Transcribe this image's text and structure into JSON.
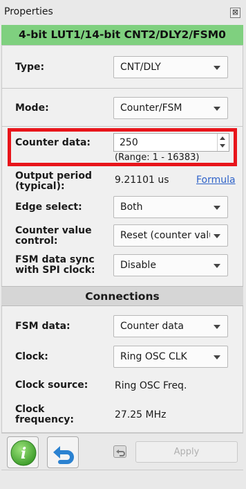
{
  "window": {
    "title": "Properties",
    "close_glyph": "⊠"
  },
  "header": {
    "title": "4-bit LUT1/14-bit CNT2/DLY2/FSM0"
  },
  "properties": {
    "type": {
      "label": "Type:",
      "value": "CNT/DLY"
    },
    "mode": {
      "label": "Mode:",
      "value": "Counter/FSM"
    },
    "counter_data": {
      "label": "Counter data:",
      "value": "250",
      "range": "(Range:  1 - 16383)"
    },
    "output_period": {
      "label_line1": "Output period",
      "label_line2": "(typical):",
      "value": "9.21101 us",
      "link": "Formula"
    },
    "edge_select": {
      "label": "Edge select:",
      "value": "Both"
    },
    "counter_value_control": {
      "label_line1": "Counter value",
      "label_line2": "control:",
      "value": "Reset (counter value"
    },
    "fsm_data_sync": {
      "label_line1": "FSM data sync",
      "label_line2": "with SPI clock:",
      "value": "Disable"
    }
  },
  "connections": {
    "title": "Connections",
    "fsm_data": {
      "label": "FSM data:",
      "value": "Counter data"
    },
    "clock": {
      "label": "Clock:",
      "value": "Ring OSC CLK"
    },
    "clock_source": {
      "label": "Clock source:",
      "value": "Ring OSC Freq."
    },
    "clock_frequency": {
      "label_line1": "Clock",
      "label_line2": "frequency:",
      "value": "27.25 MHz"
    }
  },
  "footer": {
    "apply_label": "Apply",
    "info_icon": "info-icon",
    "undo_icon": "undo-icon",
    "revert_icon": "revert-icon"
  },
  "colors": {
    "header_green": "#7fd07f",
    "highlight_red": "#e8151b",
    "link_blue": "#2f63c9"
  }
}
